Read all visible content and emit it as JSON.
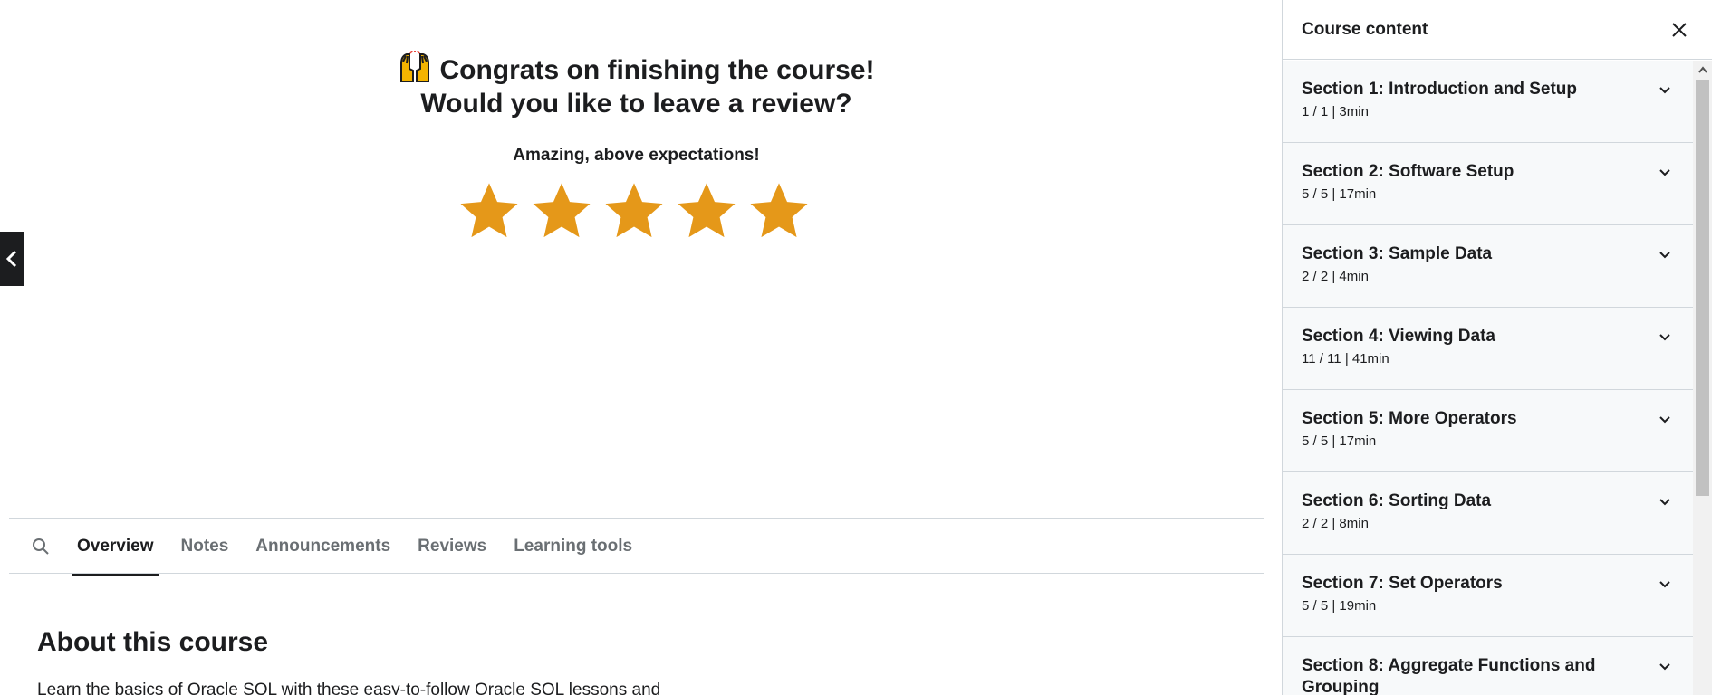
{
  "congrats": {
    "line1": "Congrats on finishing the course!",
    "line2": "Would you like to leave a review?",
    "emoji_icon": "raising-hands-emoji"
  },
  "review": {
    "rating_label": "Amazing, above expectations!",
    "rating": 5,
    "max_rating": 5,
    "star_color": "#e59819"
  },
  "tabs": [
    {
      "label": "Overview",
      "active": true
    },
    {
      "label": "Notes",
      "active": false
    },
    {
      "label": "Announcements",
      "active": false
    },
    {
      "label": "Reviews",
      "active": false
    },
    {
      "label": "Learning tools",
      "active": false
    }
  ],
  "about": {
    "title": "About this course",
    "text": "Learn the basics of Oracle SQL with these easy-to-follow Oracle SQL lessons and"
  },
  "sidebar": {
    "title": "Course content",
    "sections": [
      {
        "title": "Section 1: Introduction and Setup",
        "meta": "1 / 1 | 3min"
      },
      {
        "title": "Section 2: Software Setup",
        "meta": "5 / 5 | 17min"
      },
      {
        "title": "Section 3: Sample Data",
        "meta": "2 / 2 | 4min"
      },
      {
        "title": "Section 4: Viewing Data",
        "meta": "11 / 11 | 41min"
      },
      {
        "title": "Section 5: More Operators",
        "meta": "5 / 5 | 17min"
      },
      {
        "title": "Section 6: Sorting Data",
        "meta": "2 / 2 | 8min"
      },
      {
        "title": "Section 7: Set Operators",
        "meta": "5 / 5 | 19min"
      },
      {
        "title": "Section 8: Aggregate Functions and Grouping",
        "meta": ""
      }
    ]
  },
  "colors": {
    "text": "#1c1d1f",
    "muted": "#6a6f73",
    "sidebar_bg": "#f7f9fa",
    "border": "#d1d7dc"
  }
}
